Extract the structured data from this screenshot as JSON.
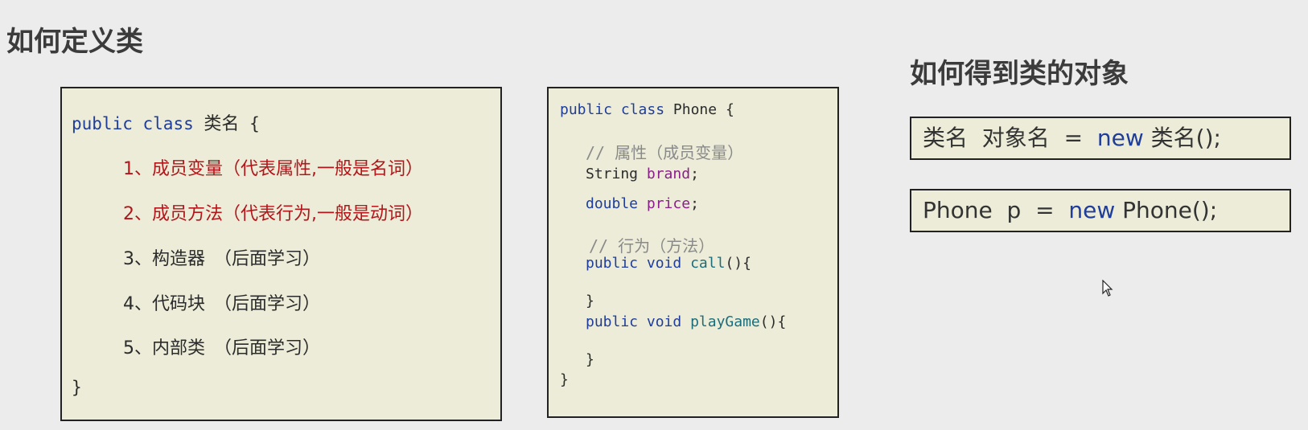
{
  "left_title": "如何定义类",
  "right_title": "如何得到类的对象",
  "class_template": {
    "kw_public": "public",
    "kw_class": "class",
    "class_name": "类名",
    "open_brace": "{",
    "items": [
      "1、成员变量（代表属性,一般是名词）",
      "2、成员方法（代表行为,一般是动词）",
      "3、构造器　（后面学习）",
      "4、代码块　（后面学习）",
      "5、内部类　（后面学习）"
    ],
    "close_brace": "}"
  },
  "phone_example": {
    "kw_public": "public",
    "kw_class": "class",
    "class_name": "Phone",
    "open_brace": "{",
    "comment_fields_slash": "// ",
    "comment_fields": "属性（成员变量）",
    "field1_type": "String",
    "field1_name": "brand",
    "field2_type": "double",
    "field2_name": "price",
    "semicolon": ";",
    "comment_methods_slash": "// ",
    "comment_methods": "行为（方法）",
    "m1_mod": "public",
    "m1_ret": "void",
    "m1_name": "call",
    "m1_sig": "(){",
    "m1_close": "}",
    "m2_mod": "public",
    "m2_ret": "void",
    "m2_name": "playGame",
    "m2_sig": "(){",
    "m2_close": "}",
    "close_brace": "}"
  },
  "object_syntax": {
    "generic_pre": "类名  对象名  =  ",
    "generic_new": "new",
    "generic_post": " 类名();",
    "phone_pre": "Phone  p  =  ",
    "phone_new": "new",
    "phone_post": " Phone();"
  }
}
